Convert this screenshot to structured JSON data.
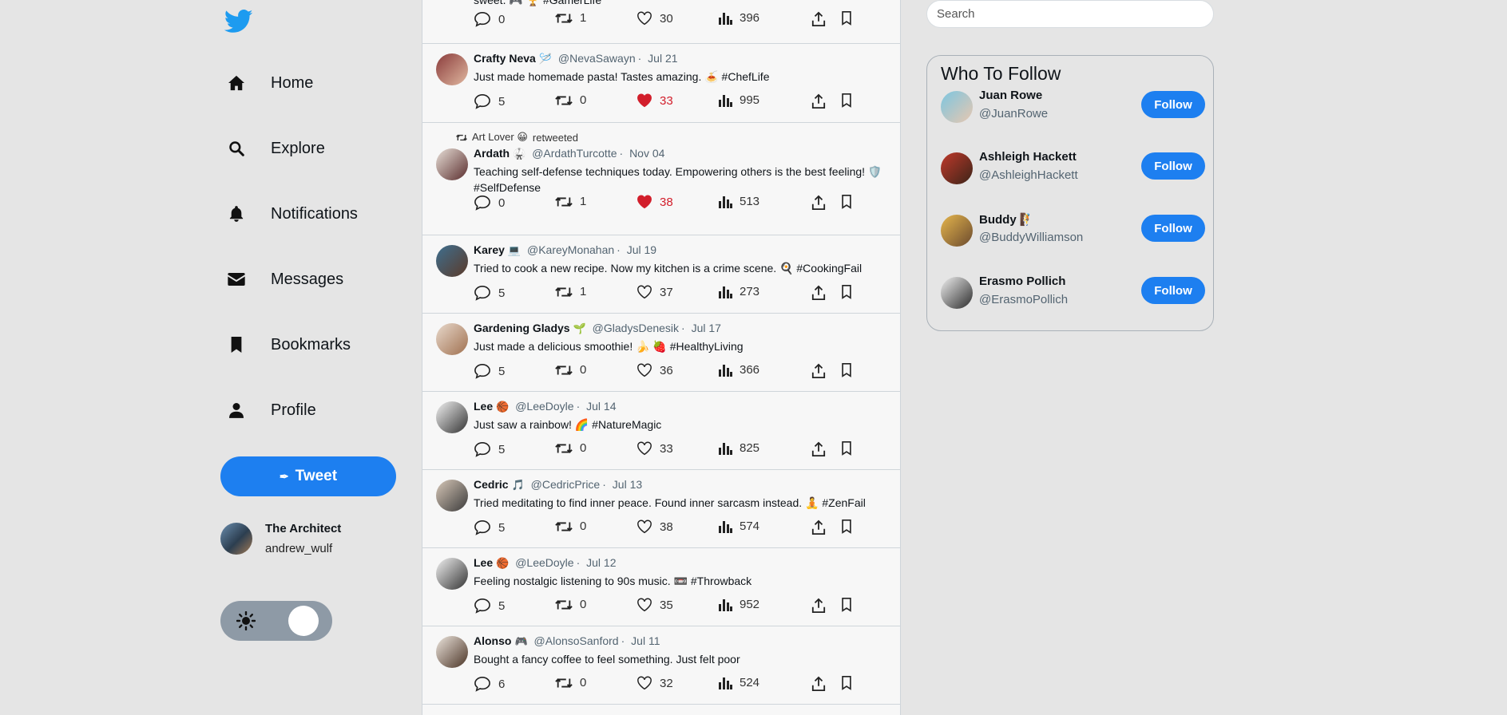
{
  "sidebar": {
    "logo_icon": "twitter-bird-icon",
    "nav": [
      {
        "label": "Home",
        "icon": "home-icon"
      },
      {
        "label": "Explore",
        "icon": "search-icon"
      },
      {
        "label": "Notifications",
        "icon": "bell-icon"
      },
      {
        "label": "Messages",
        "icon": "envelope-icon"
      },
      {
        "label": "Bookmarks",
        "icon": "bookmark-icon"
      },
      {
        "label": "Profile",
        "icon": "user-icon"
      }
    ],
    "tweet_button": "Tweet",
    "user": {
      "name": "The Architect",
      "handle": "andrew_wulf"
    },
    "theme_toggle_icon": "sun-icon"
  },
  "feed": {
    "top_partial": {
      "text": "sweet. 🎮 🏆 #GamerLife",
      "replies": "0",
      "retweets": "1",
      "likes": "30",
      "views": "396"
    },
    "tweets": [
      {
        "name": "Crafty Neva",
        "emoji": "🪡",
        "handle": "@NevaSawayn",
        "date": "Jul 21",
        "text": "Just made homemade pasta! Tastes amazing. 🍝 #ChefLife",
        "replies": "5",
        "retweets": "0",
        "likes": "33",
        "views": "995",
        "liked": true
      },
      {
        "retweeted_by": "Art Lover 😀",
        "retweeted_label": "retweeted",
        "name": "Ardath",
        "emoji": "🥋",
        "handle": "@ArdathTurcotte",
        "date": "Nov 04",
        "text": "Teaching self-defense techniques today. Empowering others is the best feeling! 🛡️ #SelfDefense",
        "replies": "0",
        "retweets": "1",
        "likes": "38",
        "views": "513",
        "liked": true
      },
      {
        "name": "Karey",
        "emoji": "💻",
        "handle": "@KareyMonahan",
        "date": "Jul 19",
        "text": "Tried to cook a new recipe. Now my kitchen is a crime scene. 🍳 #CookingFail",
        "replies": "5",
        "retweets": "1",
        "likes": "37",
        "views": "273",
        "liked": false
      },
      {
        "name": "Gardening Gladys",
        "emoji": "🌱",
        "handle": "@GladysDenesik",
        "date": "Jul 17",
        "text": "Just made a delicious smoothie! 🍌 🍓 #HealthyLiving",
        "replies": "5",
        "retweets": "0",
        "likes": "36",
        "views": "366",
        "liked": false
      },
      {
        "name": "Lee",
        "emoji": "🏀",
        "handle": "@LeeDoyle",
        "date": "Jul 14",
        "text": "Just saw a rainbow! 🌈 #NatureMagic",
        "replies": "5",
        "retweets": "0",
        "likes": "33",
        "views": "825",
        "liked": false
      },
      {
        "name": "Cedric",
        "emoji": "🎵",
        "handle": "@CedricPrice",
        "date": "Jul 13",
        "text": "Tried meditating to find inner peace. Found inner sarcasm instead. 🧘 #ZenFail",
        "replies": "5",
        "retweets": "0",
        "likes": "38",
        "views": "574",
        "liked": false
      },
      {
        "name": "Lee",
        "emoji": "🏀",
        "handle": "@LeeDoyle",
        "date": "Jul 12",
        "text": "Feeling nostalgic listening to 90s music. 📼 #Throwback",
        "replies": "5",
        "retweets": "0",
        "likes": "35",
        "views": "952",
        "liked": false
      },
      {
        "name": "Alonso",
        "emoji": "🎮",
        "handle": "@AlonsoSanford",
        "date": "Jul 11",
        "text": "Bought a fancy coffee to feel something. Just felt poor",
        "replies": "6",
        "retweets": "0",
        "likes": "32",
        "views": "524",
        "liked": false
      }
    ]
  },
  "right": {
    "search_placeholder": "Search",
    "who_to_follow_title": "Who To Follow",
    "follow_label": "Follow",
    "suggestions": [
      {
        "name": "Juan Rowe",
        "emoji": "",
        "handle": "@JuanRowe"
      },
      {
        "name": "Ashleigh Hackett",
        "emoji": "",
        "handle": "@AshleighHackett"
      },
      {
        "name": "Buddy",
        "emoji": "🧗",
        "handle": "@BuddyWilliamson"
      },
      {
        "name": "Erasmo Pollich",
        "emoji": "",
        "handle": "@ErasmoPollich"
      }
    ]
  },
  "colors": {
    "accent": "#1d7ff0",
    "like": "#d21e2b",
    "background": "#e5e5e5",
    "feed_bg": "#f7f7f7"
  }
}
